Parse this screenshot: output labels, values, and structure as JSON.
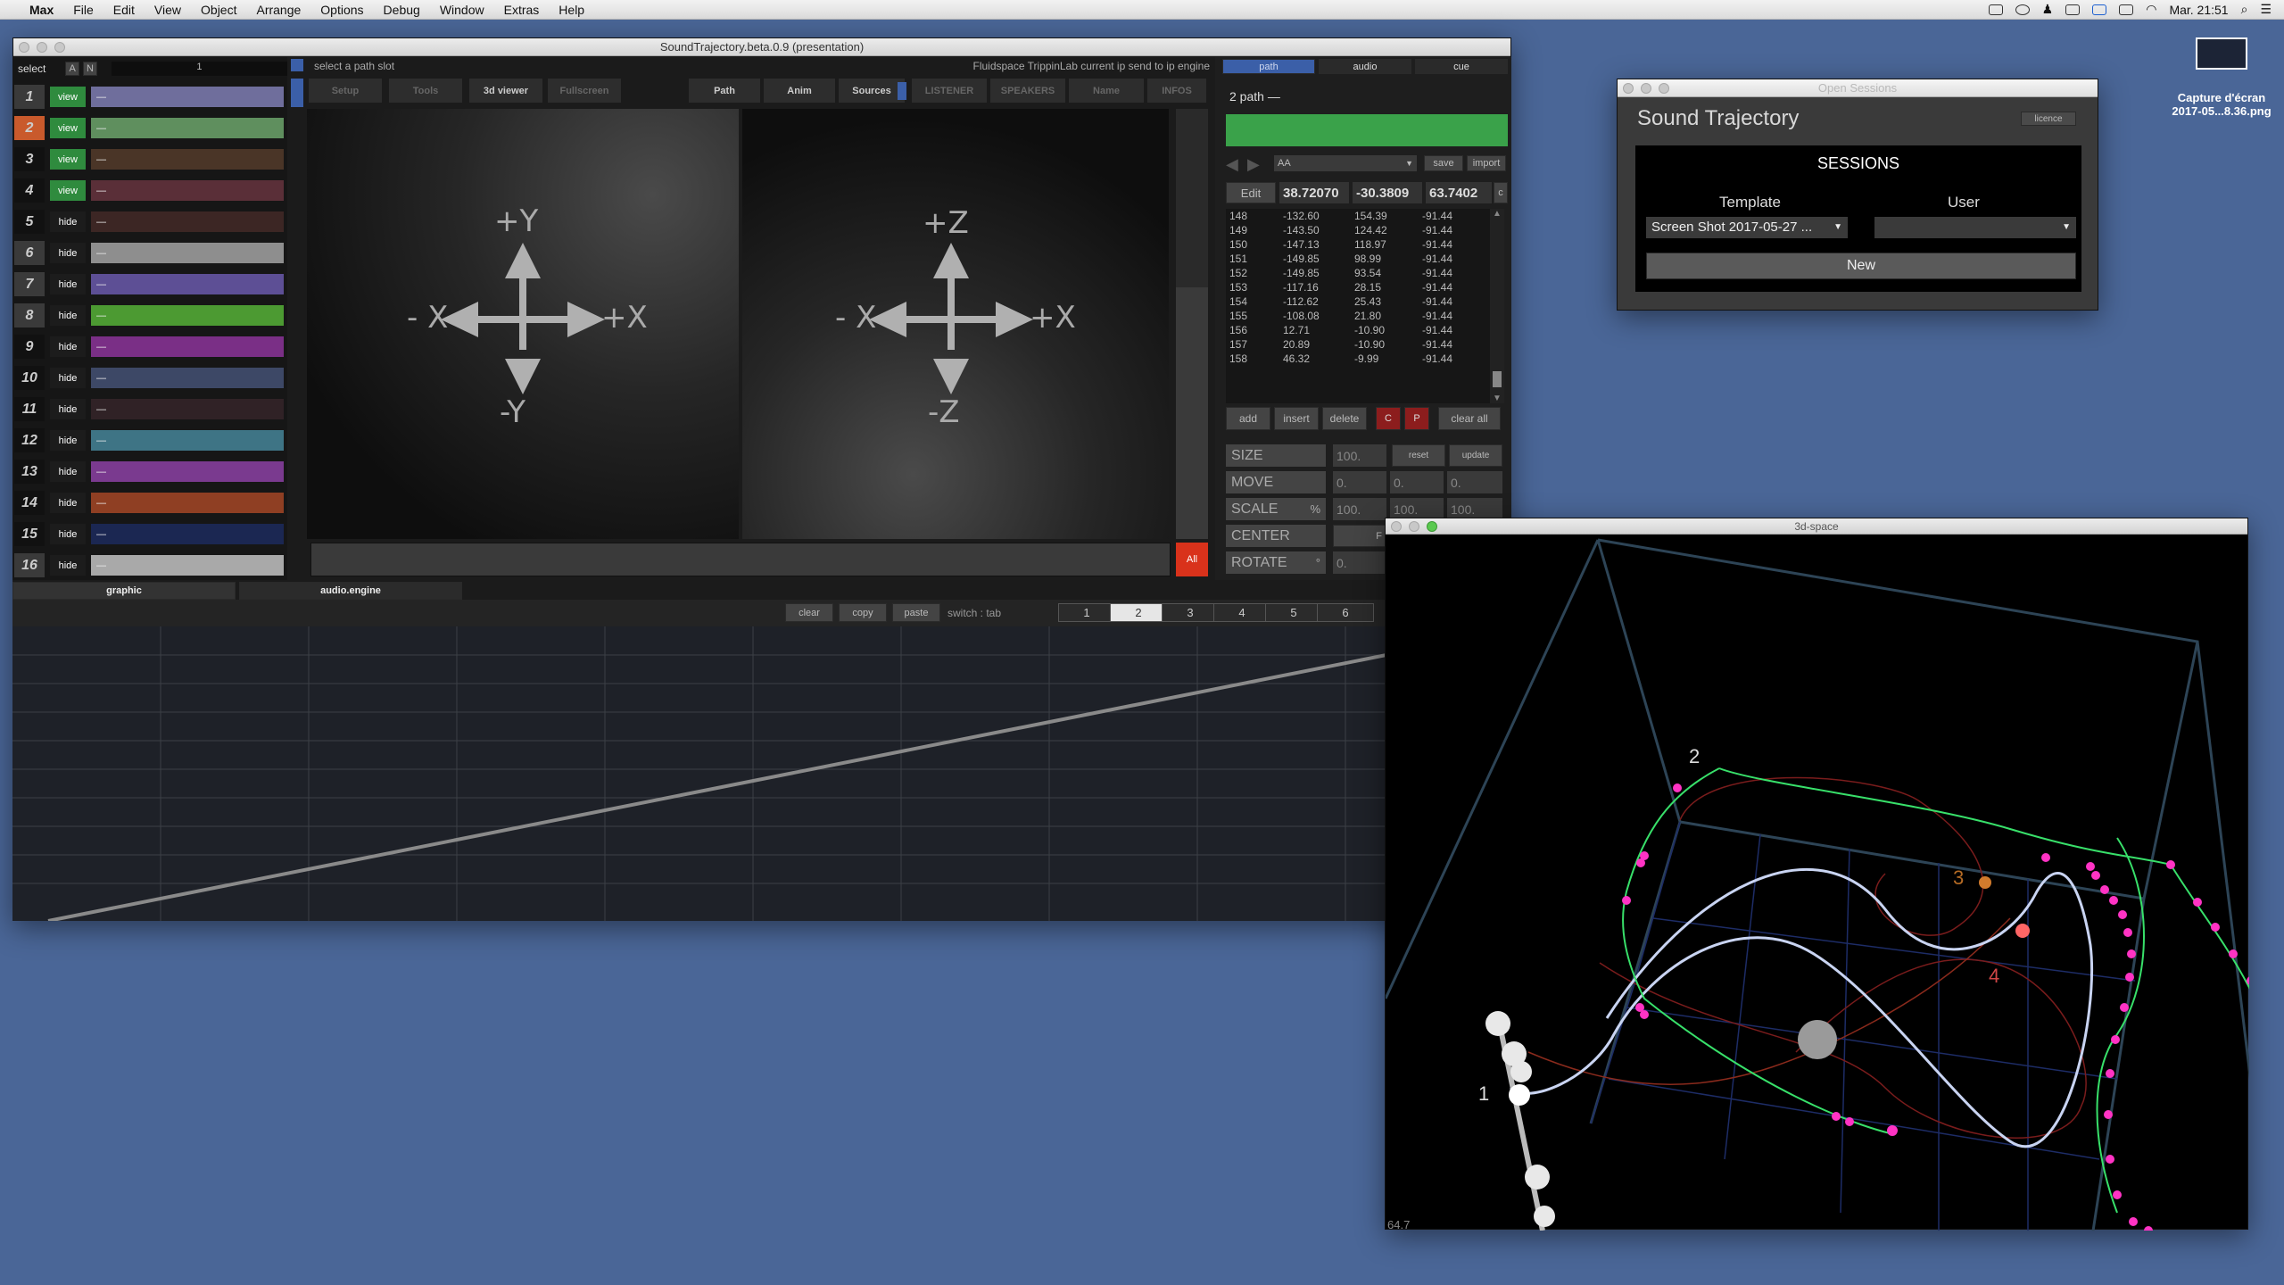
{
  "menubar": {
    "app": "Max",
    "items": [
      "File",
      "Edit",
      "View",
      "Object",
      "Arrange",
      "Options",
      "Debug",
      "Window",
      "Extras",
      "Help"
    ],
    "clock": "Mar. 21:51"
  },
  "main_window": {
    "title": "SoundTrajectory.beta.0.9 (presentation)"
  },
  "source_panel": {
    "header": {
      "select": "select",
      "a": "A",
      "n": "N",
      "slot": "1"
    },
    "rows": [
      {
        "num": "1",
        "state": "view",
        "label": "—",
        "num_color": "#3a3a3a",
        "bar_color": "#6f6e9c",
        "btn_color": "#2f8b3e"
      },
      {
        "num": "2",
        "state": "view",
        "label": "—",
        "num_color": "#c95a2c",
        "bar_color": "#5f8f5e",
        "btn_color": "#2f8b3e"
      },
      {
        "num": "3",
        "state": "view",
        "label": "—",
        "num_color": "#111111",
        "bar_color": "#4a3527",
        "btn_color": "#2f8b3e"
      },
      {
        "num": "4",
        "state": "view",
        "label": "—",
        "num_color": "#111111",
        "bar_color": "#5a2f38",
        "btn_color": "#2f8b3e"
      },
      {
        "num": "5",
        "state": "hide",
        "label": "—",
        "num_color": "#111111",
        "bar_color": "#3c2624",
        "btn_color": "#1c1c1c"
      },
      {
        "num": "6",
        "state": "hide",
        "label": "—",
        "num_color": "#3a3a3a",
        "bar_color": "#8e8e8e",
        "btn_color": "#1c1c1c"
      },
      {
        "num": "7",
        "state": "hide",
        "label": "—",
        "num_color": "#3a3a3a",
        "bar_color": "#5d4f95",
        "btn_color": "#1c1c1c"
      },
      {
        "num": "8",
        "state": "hide",
        "label": "—",
        "num_color": "#3a3a3a",
        "bar_color": "#4c9a32",
        "btn_color": "#1c1c1c"
      },
      {
        "num": "9",
        "state": "hide",
        "label": "—",
        "num_color": "#111111",
        "bar_color": "#7a2f86",
        "btn_color": "#1c1c1c"
      },
      {
        "num": "10",
        "state": "hide",
        "label": "—",
        "num_color": "#111111",
        "bar_color": "#3d4866",
        "btn_color": "#1c1c1c"
      },
      {
        "num": "11",
        "state": "hide",
        "label": "—",
        "num_color": "#111111",
        "bar_color": "#302226",
        "btn_color": "#1c1c1c"
      },
      {
        "num": "12",
        "state": "hide",
        "label": "—",
        "num_color": "#111111",
        "bar_color": "#3e7485",
        "btn_color": "#1c1c1c"
      },
      {
        "num": "13",
        "state": "hide",
        "label": "—",
        "num_color": "#111111",
        "bar_color": "#7a3a8f",
        "btn_color": "#1c1c1c"
      },
      {
        "num": "14",
        "state": "hide",
        "label": "—",
        "num_color": "#111111",
        "bar_color": "#8f3f23",
        "btn_color": "#1c1c1c"
      },
      {
        "num": "15",
        "state": "hide",
        "label": "—",
        "num_color": "#111111",
        "bar_color": "#1b2752",
        "btn_color": "#1c1c1c"
      },
      {
        "num": "16",
        "state": "hide",
        "label": "—",
        "num_color": "#3a3a3a",
        "bar_color": "#a9a9a9",
        "btn_color": "#1c1c1c"
      }
    ]
  },
  "center": {
    "status_left": "select a path slot",
    "status_right": "Fluidspace TrippinLab current ip send to ip engine",
    "tabs_left": [
      "Setup",
      "Tools",
      "3d viewer",
      "Fullscreen"
    ],
    "tabs_right": [
      "Path",
      "Anim",
      "Sources",
      "LISTENER",
      "SPEAKERS",
      "Name",
      "INFOS"
    ],
    "axes_xy": {
      "top": "+Y",
      "bottom": "-Y",
      "left": "- X",
      "right": "+X"
    },
    "axes_xz": {
      "top": "+Z",
      "bottom": "-Z",
      "left": "- X",
      "right": "+X"
    },
    "all_button": "All"
  },
  "bottom_tabs": [
    "graphic",
    "audio.engine"
  ],
  "graphic": {
    "buttons": [
      "clear",
      "copy",
      "paste"
    ],
    "switch_label": "switch : tab",
    "numbers": [
      "1",
      "2",
      "3",
      "4",
      "5",
      "6"
    ],
    "selected": "2"
  },
  "path_panel": {
    "tabs": [
      "path",
      "audio",
      "cue"
    ],
    "path_name": "2 path —",
    "preset": "AA",
    "save": "save",
    "import": "import",
    "edit": "Edit",
    "coords": [
      "38.72070",
      "-30.3809",
      "63.7402"
    ],
    "c": "c",
    "points": [
      [
        "148",
        "-132.60",
        "154.39",
        "-91.44"
      ],
      [
        "149",
        "-143.50",
        "124.42",
        "-91.44"
      ],
      [
        "150",
        "-147.13",
        "118.97",
        "-91.44"
      ],
      [
        "151",
        "-149.85",
        "98.99",
        "-91.44"
      ],
      [
        "152",
        "-149.85",
        "93.54",
        "-91.44"
      ],
      [
        "153",
        "-117.16",
        "28.15",
        "-91.44"
      ],
      [
        "154",
        "-112.62",
        "25.43",
        "-91.44"
      ],
      [
        "155",
        "-108.08",
        "21.80",
        "-91.44"
      ],
      [
        "156",
        "12.71",
        "-10.90",
        "-91.44"
      ],
      [
        "157",
        "20.89",
        "-10.90",
        "-91.44"
      ],
      [
        "158",
        "46.32",
        "-9.99",
        "-91.44"
      ]
    ],
    "edit_buttons": [
      "add",
      "insert",
      "delete",
      "C",
      "P",
      "clear all"
    ],
    "transforms": {
      "size": {
        "label": "SIZE",
        "value": "100.",
        "reset": "reset",
        "update": "update"
      },
      "move": {
        "label": "MOVE",
        "values": [
          "0.",
          "0.",
          "0."
        ]
      },
      "scale": {
        "label": "SCALE",
        "unit": "%",
        "values": [
          "100.",
          "100.",
          "100."
        ]
      },
      "center": {
        "label": "CENTER",
        "value": "F"
      },
      "rotate": {
        "label": "ROTATE",
        "unit": "°",
        "value": "0."
      }
    }
  },
  "sessions": {
    "window_title": "Open Sessions",
    "app_title": "Sound Trajectory",
    "licence": "licence",
    "heading": "SESSIONS",
    "template_label": "Template",
    "user_label": "User",
    "template_value": "Screen Shot 2017-05-27 ...",
    "user_value": "",
    "new_button": "New"
  },
  "space3d": {
    "title": "3d-space",
    "fps": "64.7",
    "labels": [
      "1",
      "2",
      "3",
      "4"
    ]
  },
  "desktop_file": {
    "name_line1": "Capture d'écran",
    "name_line2": "2017-05...8.36.png"
  }
}
